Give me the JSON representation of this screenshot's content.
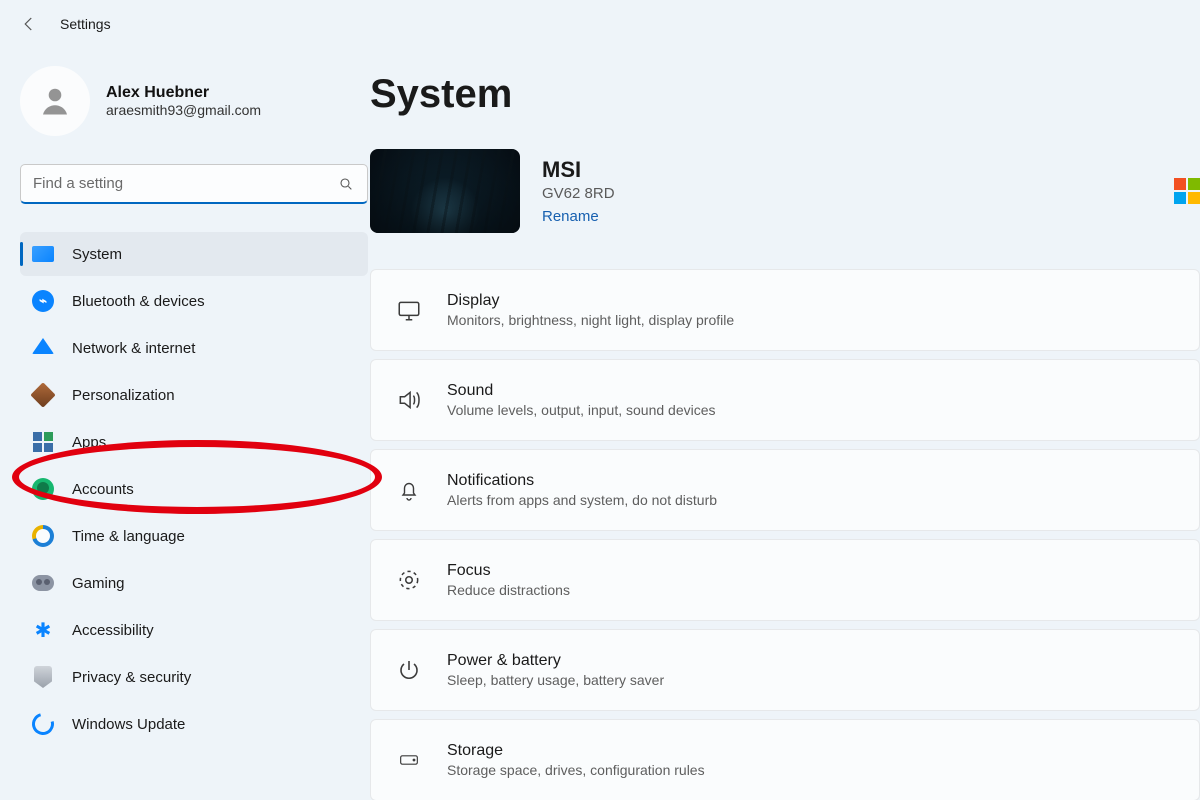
{
  "app_title": "Settings",
  "account": {
    "name": "Alex Huebner",
    "email": "araesmith93@gmail.com"
  },
  "search": {
    "placeholder": "Find a setting",
    "value": ""
  },
  "sidebar": {
    "items": [
      {
        "label": "System",
        "icon": "system-icon",
        "active": true
      },
      {
        "label": "Bluetooth & devices",
        "icon": "bluetooth-icon"
      },
      {
        "label": "Network & internet",
        "icon": "network-icon"
      },
      {
        "label": "Personalization",
        "icon": "personalization-icon",
        "highlighted": true
      },
      {
        "label": "Apps",
        "icon": "apps-icon"
      },
      {
        "label": "Accounts",
        "icon": "accounts-icon"
      },
      {
        "label": "Time & language",
        "icon": "time-language-icon"
      },
      {
        "label": "Gaming",
        "icon": "gaming-icon"
      },
      {
        "label": "Accessibility",
        "icon": "accessibility-icon"
      },
      {
        "label": "Privacy & security",
        "icon": "privacy-icon"
      },
      {
        "label": "Windows Update",
        "icon": "update-icon"
      }
    ]
  },
  "main": {
    "title": "System",
    "device": {
      "name": "MSI",
      "model": "GV62 8RD",
      "rename_label": "Rename"
    },
    "cards": [
      {
        "title": "Display",
        "sub": "Monitors, brightness, night light, display profile",
        "icon": "display-icon"
      },
      {
        "title": "Sound",
        "sub": "Volume levels, output, input, sound devices",
        "icon": "sound-icon"
      },
      {
        "title": "Notifications",
        "sub": "Alerts from apps and system, do not disturb",
        "icon": "notifications-icon"
      },
      {
        "title": "Focus",
        "sub": "Reduce distractions",
        "icon": "focus-icon"
      },
      {
        "title": "Power & battery",
        "sub": "Sleep, battery usage, battery saver",
        "icon": "power-icon"
      },
      {
        "title": "Storage",
        "sub": "Storage space, drives, configuration rules",
        "icon": "storage-icon"
      }
    ]
  },
  "annotation": {
    "highlighted_item_index": 3
  }
}
